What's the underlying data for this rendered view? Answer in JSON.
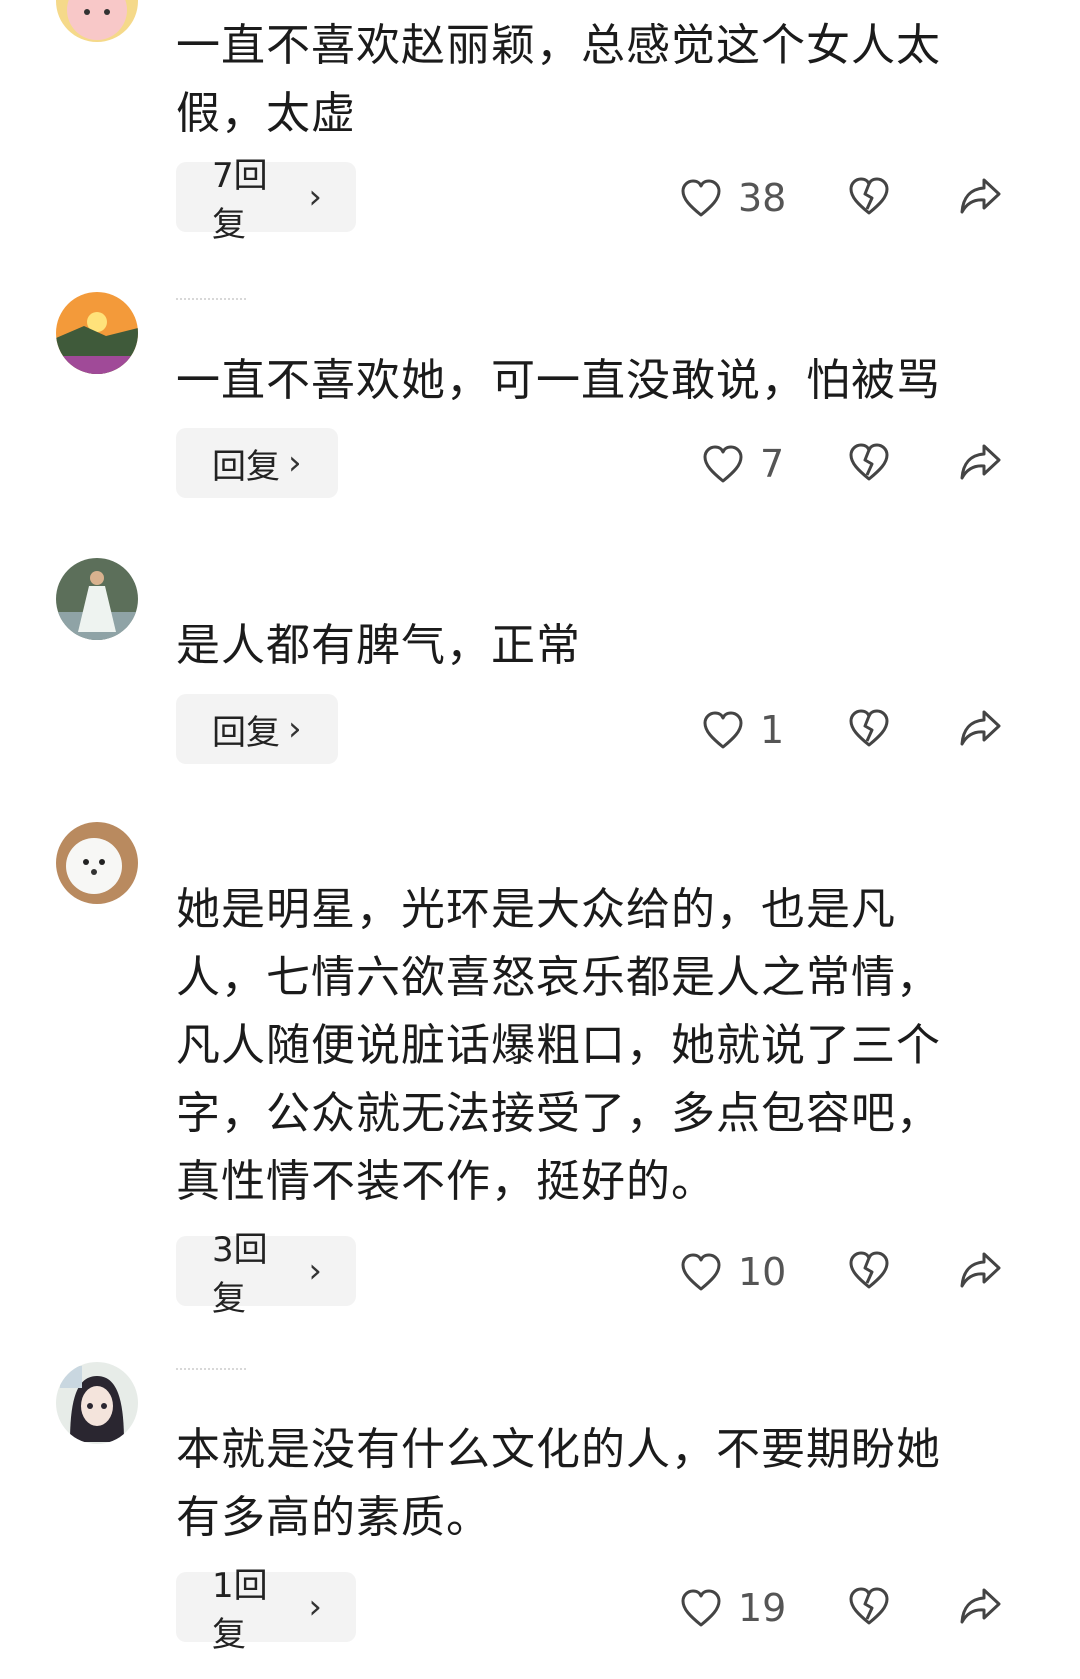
{
  "comments": [
    {
      "text": "一直不喜欢赵丽颖，总感觉这个女人太\n假，太虚",
      "reply_label": "7回复",
      "likes": "38",
      "avatar_icon": "cartoon-rabbit-avatar"
    },
    {
      "text": "一直不喜欢她，可一直没敢说，怕被骂",
      "reply_label": "回复",
      "likes": "7",
      "avatar_icon": "sunset-landscape-avatar"
    },
    {
      "text": "是人都有脾气，正常",
      "reply_label": "回复",
      "likes": "1",
      "avatar_icon": "woman-in-dress-avatar"
    },
    {
      "text": "她是明星，光环是大众给的，也是凡\n人，七情六欲喜怒哀乐都是人之常情，\n凡人随便说脏话爆粗口，她就说了三个\n字，公众就无法接受了，多点包容吧，\n真性情不装不作，挺好的。",
      "reply_label": "3回复",
      "likes": "10",
      "avatar_icon": "white-dog-avatar"
    },
    {
      "text": "本就是没有什么文化的人，不要期盼她\n有多高的素质。",
      "reply_label": "1回复",
      "likes": "19",
      "avatar_icon": "anime-girl-avatar"
    }
  ],
  "icons": {
    "like": "heart-icon",
    "dislike": "broken-heart-icon",
    "share": "share-arrow-icon",
    "chevron": "›"
  },
  "colors": {
    "reply_bg": "#f3f3f3",
    "icon_stroke": "#444444",
    "count": "#555555"
  }
}
